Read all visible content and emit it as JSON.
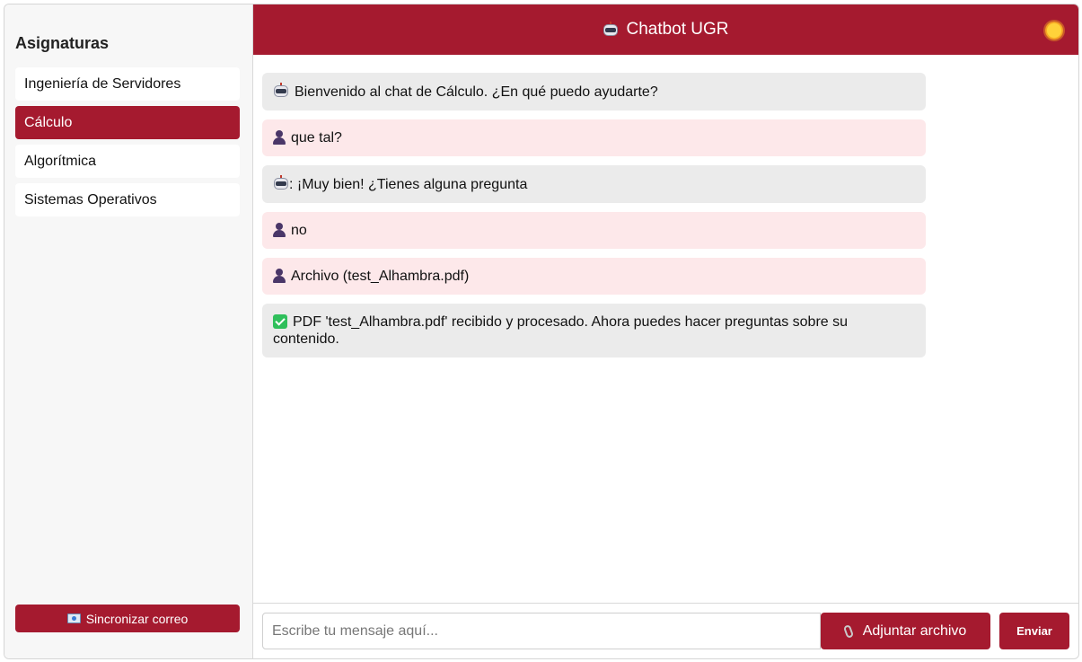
{
  "sidebar": {
    "title": "Asignaturas",
    "items": [
      {
        "label": "Ingeniería de Servidores",
        "active": false
      },
      {
        "label": "Cálculo",
        "active": true
      },
      {
        "label": "Algorítmica",
        "active": false
      },
      {
        "label": "Sistemas Operativos",
        "active": false
      }
    ],
    "sync_label": "Sincronizar correo",
    "sync_icon": "mail-icon"
  },
  "header": {
    "title": "Chatbot UGR",
    "title_icon": "robot-icon",
    "theme_icon": "sun-icon"
  },
  "messages": [
    {
      "role": "bot",
      "icon": "robot-icon",
      "text": "Bienvenido al chat de Cálculo. ¿En qué puedo ayudarte?"
    },
    {
      "role": "user",
      "icon": "user-icon",
      "text": "que tal?"
    },
    {
      "role": "bot",
      "icon": "robot-icon",
      "text": ": ¡Muy bien! ¿Tienes alguna pregunta"
    },
    {
      "role": "user",
      "icon": "user-icon",
      "text": "no"
    },
    {
      "role": "user",
      "icon": "user-icon",
      "text": "Archivo (test_Alhambra.pdf)"
    },
    {
      "role": "bot",
      "icon": "check-icon",
      "text": "PDF 'test_Alhambra.pdf' recibido y procesado. Ahora puedes hacer preguntas sobre su contenido."
    }
  ],
  "input": {
    "placeholder": "Escribe tu mensaje aquí...",
    "value": "",
    "attach_label": "Adjuntar archivo",
    "attach_icon": "paperclip-icon",
    "send_label": "Enviar"
  },
  "colors": {
    "accent": "#a51a2f",
    "bot_bubble": "#ebebeb",
    "user_bubble": "#fde8ea"
  }
}
